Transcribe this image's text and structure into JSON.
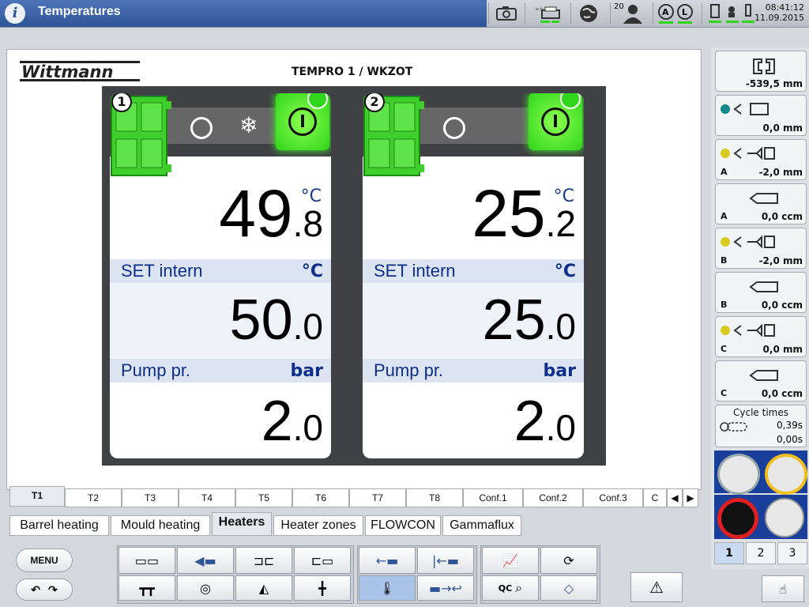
{
  "header": {
    "title": "Temperatures",
    "counter": "20",
    "time": "08:41:12",
    "date": "11.09.2015"
  },
  "panel": {
    "title": "TEMPRO 1 / WKZOT",
    "logo": "Wittmann"
  },
  "units": [
    {
      "num": "1",
      "actual_int": "49",
      "actual_dec": ".8",
      "actual_unit": "°C",
      "set_label": "SET intern",
      "set_unit": "°C",
      "set_int": "50",
      "set_dec": ".0",
      "pump_label": "Pump pr.",
      "pump_unit": "bar",
      "pump_int": "2",
      "pump_dec": ".0"
    },
    {
      "num": "2",
      "actual_int": "25",
      "actual_dec": ".2",
      "actual_unit": "°C",
      "set_label": "SET intern",
      "set_unit": "°C",
      "set_int": "25",
      "set_dec": ".0",
      "pump_label": "Pump pr.",
      "pump_unit": "bar",
      "pump_int": "2",
      "pump_dec": ".0"
    }
  ],
  "tabs": [
    "T1",
    "T2",
    "T3",
    "T4",
    "T5",
    "T6",
    "T7",
    "T8",
    "Conf.1",
    "Conf.2",
    "Conf.3",
    "C"
  ],
  "bottom_tabs": [
    "Barrel heating",
    "Mould heating",
    "Heaters",
    "Heater zones",
    "FLOWCON",
    "Gammaflux"
  ],
  "sidebar": {
    "items": [
      {
        "label": "",
        "value": "-539,5 mm"
      },
      {
        "label": "",
        "value": "0,0 mm"
      },
      {
        "label": "A",
        "value": "-2,0 mm"
      },
      {
        "label": "A",
        "value": "0,0 ccm"
      },
      {
        "label": "B",
        "value": "-2,0 mm"
      },
      {
        "label": "B",
        "value": "0,0 ccm"
      },
      {
        "label": "C",
        "value": "0,0 mm"
      },
      {
        "label": "C",
        "value": "0,0 ccm"
      }
    ],
    "cycle": {
      "title": "Cycle times",
      "v1": "0,39s",
      "v2": "0,00s"
    },
    "pages": [
      "1",
      "2",
      "3"
    ]
  },
  "toolbar": {
    "menu": "MENU",
    "qc": "QC"
  },
  "colors": {
    "accent": "#2e5597",
    "green": "#2fd61a",
    "blue_text": "#0e2f8a"
  }
}
